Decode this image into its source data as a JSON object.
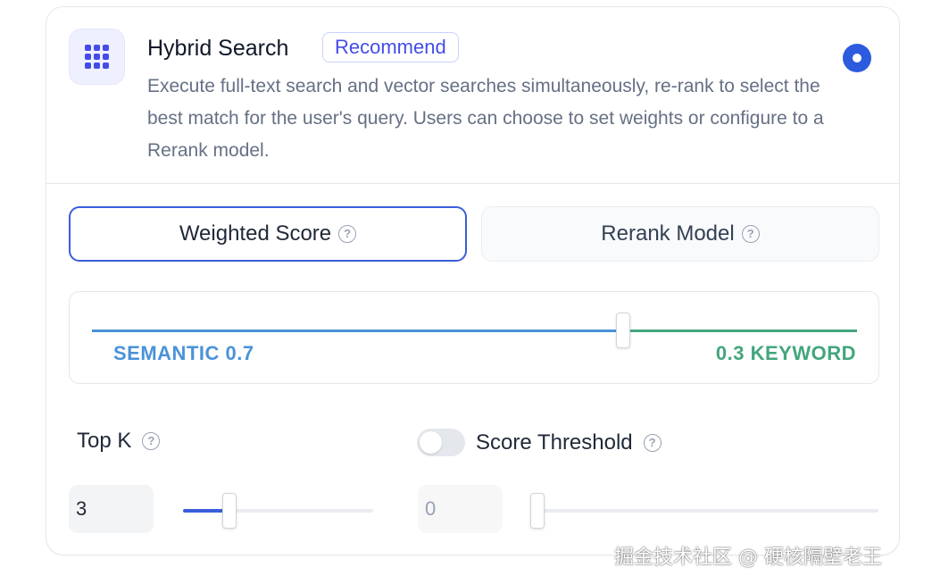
{
  "retrieval": {
    "title": "Hybrid Search",
    "badge": "Recommend",
    "description": "Execute full-text search and vector searches simultaneously, re-rank to select the best match for the user's query. Users can choose to set weights or configure to a Rerank model.",
    "selected": true,
    "icon": "grid-icon"
  },
  "mode_options": [
    {
      "label": "Weighted Score",
      "active": true
    },
    {
      "label": "Rerank Model",
      "active": false
    }
  ],
  "weights": {
    "semantic_label": "SEMANTIC 0.7",
    "keyword_label": "0.3 KEYWORD",
    "semantic_value": 0.7,
    "keyword_value": 0.3,
    "semantic_color": "#4a92d9",
    "keyword_color": "#43a67c"
  },
  "top_k": {
    "label": "Top K",
    "value": "3"
  },
  "score_threshold": {
    "label": "Score Threshold",
    "enabled": false,
    "value": "0"
  },
  "watermark": "掘金技术社区 @ 硬核隔壁老王",
  "colors": {
    "accent": "#3b5ddb",
    "badge_text": "#444ce7"
  }
}
